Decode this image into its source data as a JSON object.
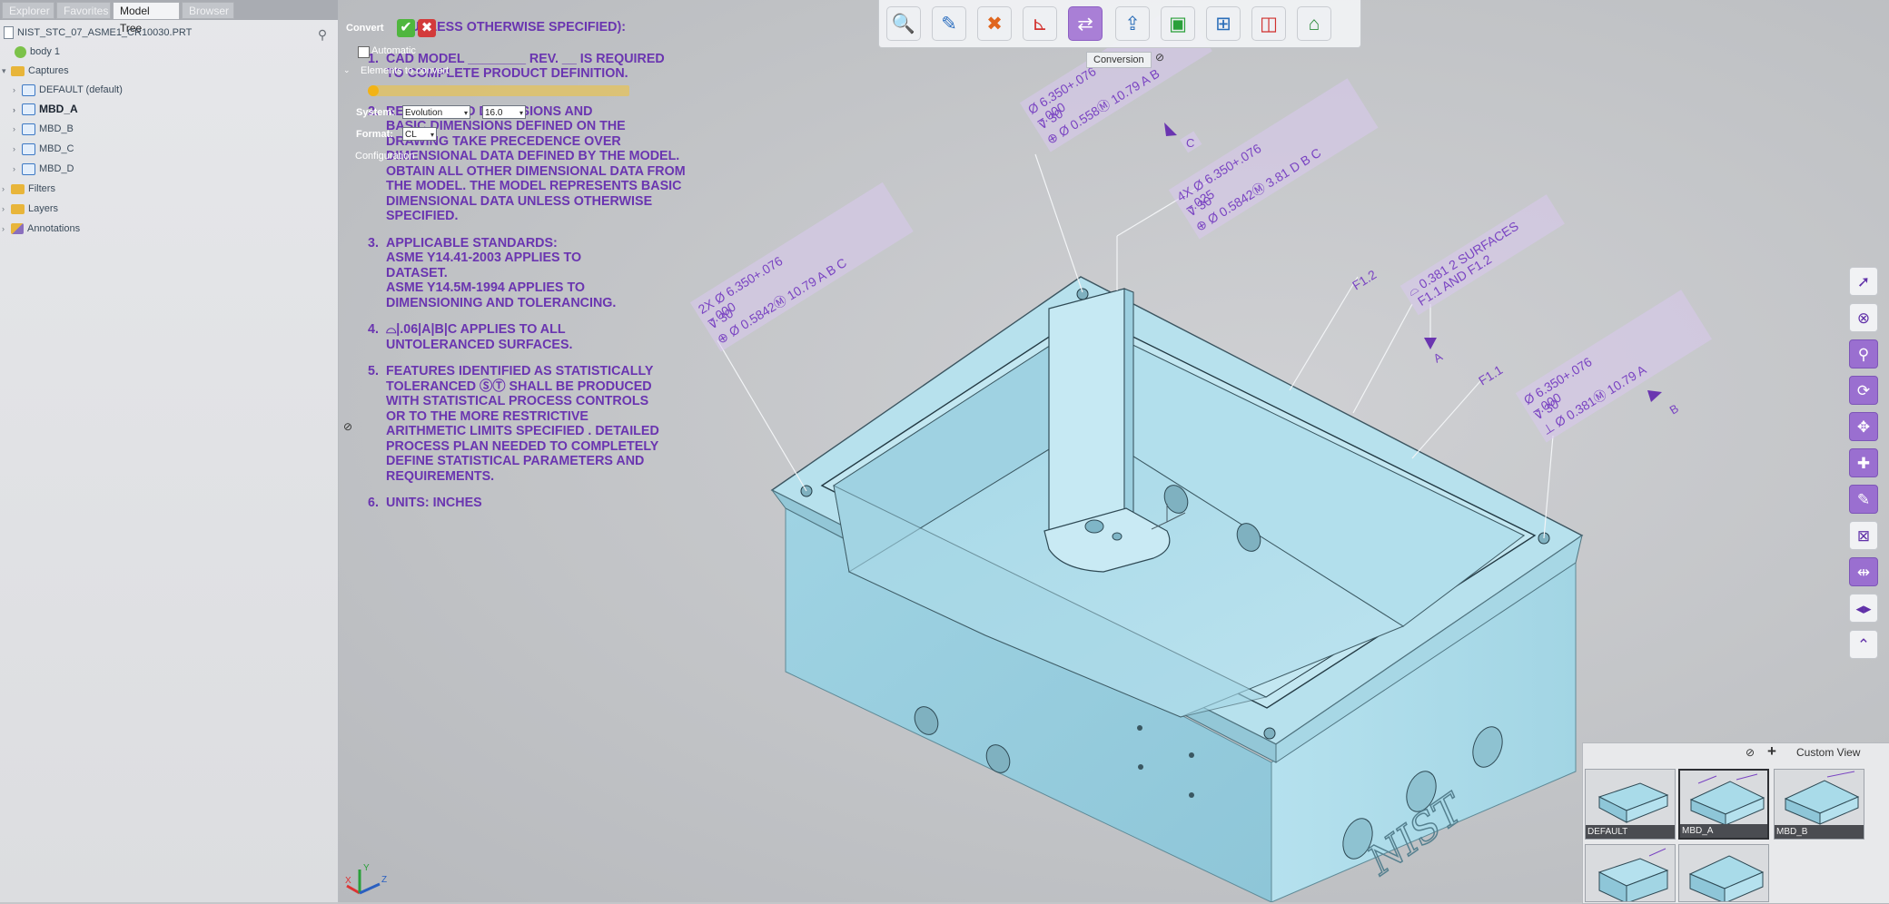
{
  "left_panel": {
    "tabs": [
      "Explorer",
      "Favorites",
      "Model Tree",
      "Browser"
    ],
    "active_tab": "Model Tree",
    "tree": [
      {
        "label": "NIST_STC_07_ASME1_CR10030.PRT",
        "icon": "file-icon"
      },
      {
        "label": "body 1",
        "icon": "body-icon"
      },
      {
        "label": "Captures",
        "icon": "folder-icon"
      },
      {
        "label": "DEFAULT (default)",
        "icon": "capture-icon"
      },
      {
        "label": "MBD_A",
        "icon": "capture-icon"
      },
      {
        "label": "MBD_B",
        "icon": "capture-icon"
      },
      {
        "label": "MBD_C",
        "icon": "capture-icon"
      },
      {
        "label": "MBD_D",
        "icon": "capture-icon"
      },
      {
        "label": "Filters",
        "icon": "folder-icon"
      },
      {
        "label": "Layers",
        "icon": "folder-icon"
      },
      {
        "label": "Annotations",
        "icon": "annotation-icon"
      }
    ]
  },
  "convert_panel": {
    "title": "Convert",
    "auto_label": "Automatic",
    "elements_label": "Elements to convert",
    "system_label": "System:",
    "system_value": "Evolution",
    "version_value": "16.0",
    "format_label": "Format:",
    "format_value": "CL",
    "config_label": "Configuration"
  },
  "notes": [
    {
      "n": "",
      "text": "(UNLESS OTHERWISE SPECIFIED):"
    },
    {
      "n": "1.",
      "text": "CAD MODEL ________ REV. __ IS REQUIRED\nTO COMPLETE PRODUCT DEFINITION."
    },
    {
      "n": "2.",
      "text": "REFERENCED DIMENSIONS AND\nBASIC DIMENSIONS DEFINED ON THE\nDRAWING TAKE PRECEDENCE OVER\nDIMENSIONAL DATA DEFINED BY THE MODEL.\nOBTAIN ALL OTHER DIMENSIONAL DATA FROM\nTHE MODEL. THE MODEL REPRESENTS BASIC\nDIMENSIONAL DATA UNLESS OTHERWISE\nSPECIFIED."
    },
    {
      "n": "3.",
      "text": "APPLICABLE STANDARDS:\nASME Y14.41-2003 APPLIES TO\nDATASET.\nASME Y14.5M-1994 APPLIES TO\nDIMENSIONING AND TOLERANCING."
    },
    {
      "n": "4.",
      "text": "⌓|.06|A|B|C APPLIES TO ALL\nUNTOLERANCED SURFACES."
    },
    {
      "n": "5.",
      "text": "FEATURES IDENTIFIED AS STATISTICALLY\nTOLERANCED ⓈⓉ SHALL BE PRODUCED\nWITH STATISTICAL PROCESS CONTROLS\nOR TO THE MORE RESTRICTIVE\nARITHMETIC LIMITS SPECIFIED . DETAILED\nPROCESS PLAN NEEDED TO COMPLETELY\nDEFINE STATISTICAL PARAMETERS AND\nREQUIREMENTS."
    },
    {
      "n": "6.",
      "text": "UNITS: INCHES"
    }
  ],
  "toolbar": {
    "buttons": [
      "zoom-icon",
      "markup-icon",
      "tools-icon",
      "measure-icon",
      "conversion-icon",
      "export-icon",
      "fit-icon",
      "layout-icon",
      "section-icon",
      "toolbox-icon"
    ],
    "selected_index": 4,
    "active_label": "Conversion"
  },
  "right_toolbar": [
    "pointer-icon",
    "hide-icon",
    "attach-icon",
    "rotate-icon",
    "move-icon",
    "add-icon",
    "edit-icon",
    "box-icon",
    "explode-icon",
    "expand-icon",
    "collapse-icon"
  ],
  "annotations": {
    "hole_top": [
      "Ø 6.350+.076\n    -.000",
      "⊽ 30",
      "⊕ Ø 0.558Ⓜ 10.79 A B"
    ],
    "datum_c": "C",
    "hole_4x": [
      "4X Ø 6.350+.076\n        -.025",
      "⊽ 30",
      "⊕ Ø 0.5842Ⓜ 3.81 D B C"
    ],
    "hole_2x": [
      "2X Ø 6.350+.076\n      -.000",
      "⊽ 30",
      "⊕ Ø 0.5842Ⓜ 10.79 A B C"
    ],
    "f12": "F1.2",
    "profile": "⌓ 0.381 2 SURFACES\n     F1.1 AND F1.2",
    "datum_a": "A",
    "f11": "F1.1",
    "hole_right": [
      "Ø 6.350+.076\n    -.000",
      "⊽ 30",
      "⊥ Ø 0.381Ⓜ 10.79 A"
    ],
    "datum_b": "B",
    "logo": "NIST"
  },
  "view_panel": {
    "title": "Custom View",
    "thumbnails": [
      "DEFAULT",
      "MBD_A",
      "MBD_B",
      "",
      ""
    ],
    "active": "MBD_A"
  },
  "axes": {
    "x": "X",
    "y": "Y",
    "z": "Z"
  },
  "colors": {
    "model": "#a9dbe9",
    "annotation": "#7a44c2",
    "note_text": "#6a35b0"
  }
}
